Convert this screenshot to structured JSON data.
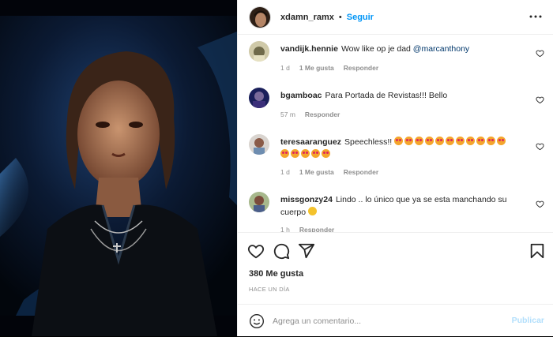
{
  "header": {
    "username": "xdamn_ramx",
    "separator": "•",
    "follow_label": "Seguir",
    "more_icon": "more-horizontal-icon"
  },
  "comments": [
    {
      "user": "vandijk.hennie",
      "text": "Wow like op je dad ",
      "mention": "@marcanthony",
      "time": "1 d",
      "likes": "1 Me gusta",
      "reply": "Responder"
    },
    {
      "user": "bgamboac",
      "text": "Para Portada de Revistas!!! Bello",
      "time": "57 m",
      "reply": "Responder"
    },
    {
      "user": "teresaaranguez",
      "text": "Speechless!!",
      "emoji_count": 16,
      "emoji": "heart-eyes-emoji",
      "time": "1 d",
      "likes": "1 Me gusta",
      "reply": "Responder"
    },
    {
      "user": "missgonzy24",
      "text": "Lindo .. lo único que ya se esta manchando su cuerpo",
      "emoji": "disappointed-face-emoji",
      "time": "1 h",
      "reply": "Responder"
    }
  ],
  "actions": {
    "like_icon": "heart-icon",
    "comment_icon": "comment-icon",
    "share_icon": "send-icon",
    "save_icon": "bookmark-icon",
    "likes_count": "380 Me gusta",
    "date": "HACE UN DÍA"
  },
  "composer": {
    "placeholder": "Agrega un comentario...",
    "publish_label": "Publicar",
    "emoji_icon": "smiley-icon"
  },
  "colors": {
    "accent": "#0095f6",
    "publish_disabled": "#b2dffc",
    "muted": "#8e8e8e"
  }
}
